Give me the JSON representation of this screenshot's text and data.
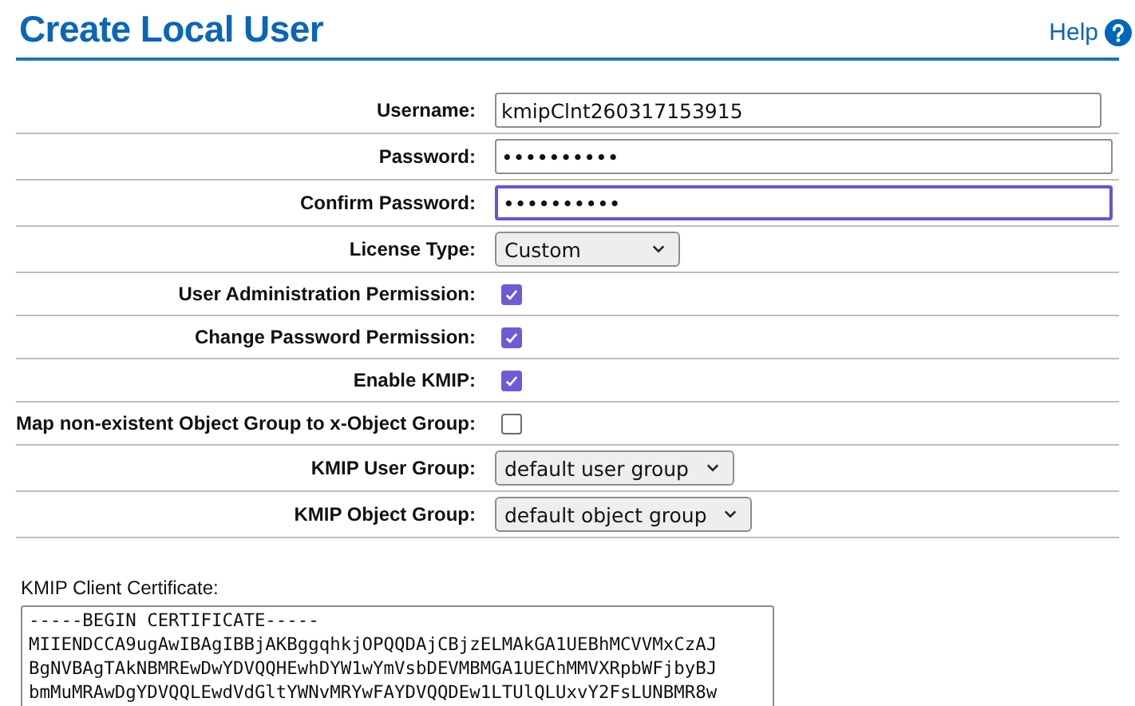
{
  "header": {
    "title": "Create Local User",
    "help": "Help"
  },
  "fields": [
    {
      "kind": "text",
      "label": "Username:",
      "value": "kmipClnt260317153915",
      "focused": false
    },
    {
      "kind": "text",
      "label": "Password:",
      "value": "••••••••••",
      "focused": false
    },
    {
      "kind": "text",
      "label": "Confirm Password:",
      "value": "••••••••••",
      "focused": true
    },
    {
      "kind": "select",
      "label": "License Type:",
      "value": "Custom"
    },
    {
      "kind": "checkbox",
      "label": "User Administration Permission:",
      "checked": true
    },
    {
      "kind": "checkbox",
      "label": "Change Password Permission:",
      "checked": true
    },
    {
      "kind": "checkbox",
      "label": "Enable KMIP:",
      "checked": true
    },
    {
      "kind": "checkbox",
      "label": "Map non-existent Object Group to x-Object Group:",
      "checked": false
    },
    {
      "kind": "select",
      "label": "KMIP User Group:",
      "value": "default user group"
    },
    {
      "kind": "select",
      "label": "KMIP Object Group:",
      "value": "default object group"
    }
  ],
  "certificate": {
    "label": "KMIP Client Certificate:",
    "lines": [
      "-----BEGIN CERTIFICATE-----",
      "MIIENDCCA9ugAwIBAgIBBjAKBggqhkjOPQQDAjCBjzELMAkGA1UEBhMCVVMxCzAJ",
      "BgNVBAgTAkNBMREwDwYDVQQHEwhDYW1wYmVsbDEVMBMGA1UEChMMVXRpbWFjbyBJ",
      "bmMuMRAwDgYDVQQLEwdVdGltYWNvMRYwFAYDVQQDEw1LTUlQLUxvY2FsLUNBMR8w"
    ]
  }
}
